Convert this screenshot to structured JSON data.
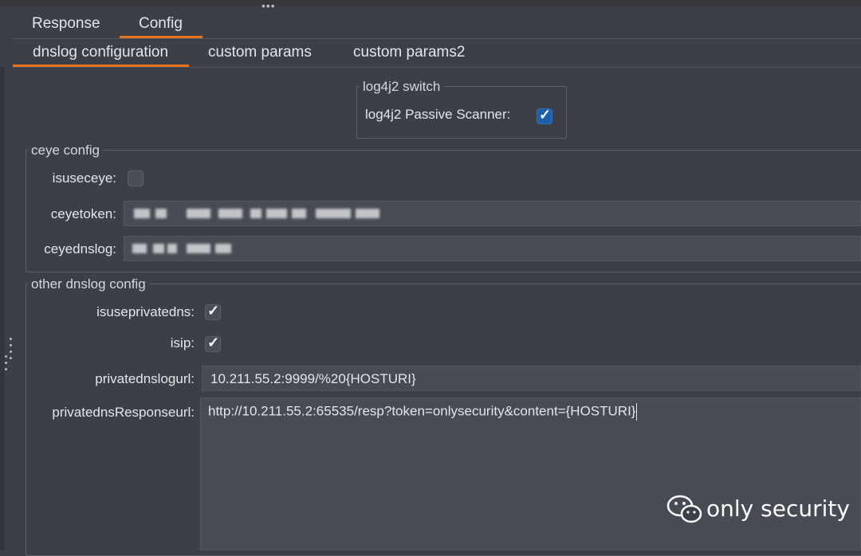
{
  "top_tabs": [
    {
      "label": "Response",
      "active": false
    },
    {
      "label": "Config",
      "active": true
    }
  ],
  "sub_tabs": [
    {
      "label": "dnslog configuration",
      "active": true
    },
    {
      "label": "custom params",
      "active": false
    },
    {
      "label": "custom params2",
      "active": false
    }
  ],
  "log4j2_switch": {
    "legend": "log4j2 switch",
    "passive_scanner_label": "log4j2 Passive Scanner:",
    "passive_scanner_checked": true
  },
  "ceye_config": {
    "legend": "ceye config",
    "isuseceye_label": "isuseceye:",
    "isuseceye_checked": false,
    "ceyetoken_label": "ceyetoken:",
    "ceyednslog_label": "ceyednslog:"
  },
  "other_dnslog_config": {
    "legend": "other dnslog config",
    "isuseprivatedns_label": "isuseprivatedns:",
    "isuseprivatedns_checked": true,
    "isip_label": "isip:",
    "isip_checked": true,
    "privatednslogurl_label": "privatednslogurl:",
    "privatednslogurl_value": "10.211.55.2:9999/%20{HOSTURI}",
    "privatednsResponseurl_label": "privatednsResponseurl:",
    "privatednsResponseurl_value": "http://10.211.55.2:65535/resp?token=onlysecurity&content={HOSTURI}"
  },
  "watermark": {
    "text": "only security",
    "icon": "wechat-icon"
  },
  "colors": {
    "background": "#3c3f47",
    "accent_underline": "#e8731e",
    "checkbox_blue": "#1f5fa8"
  }
}
